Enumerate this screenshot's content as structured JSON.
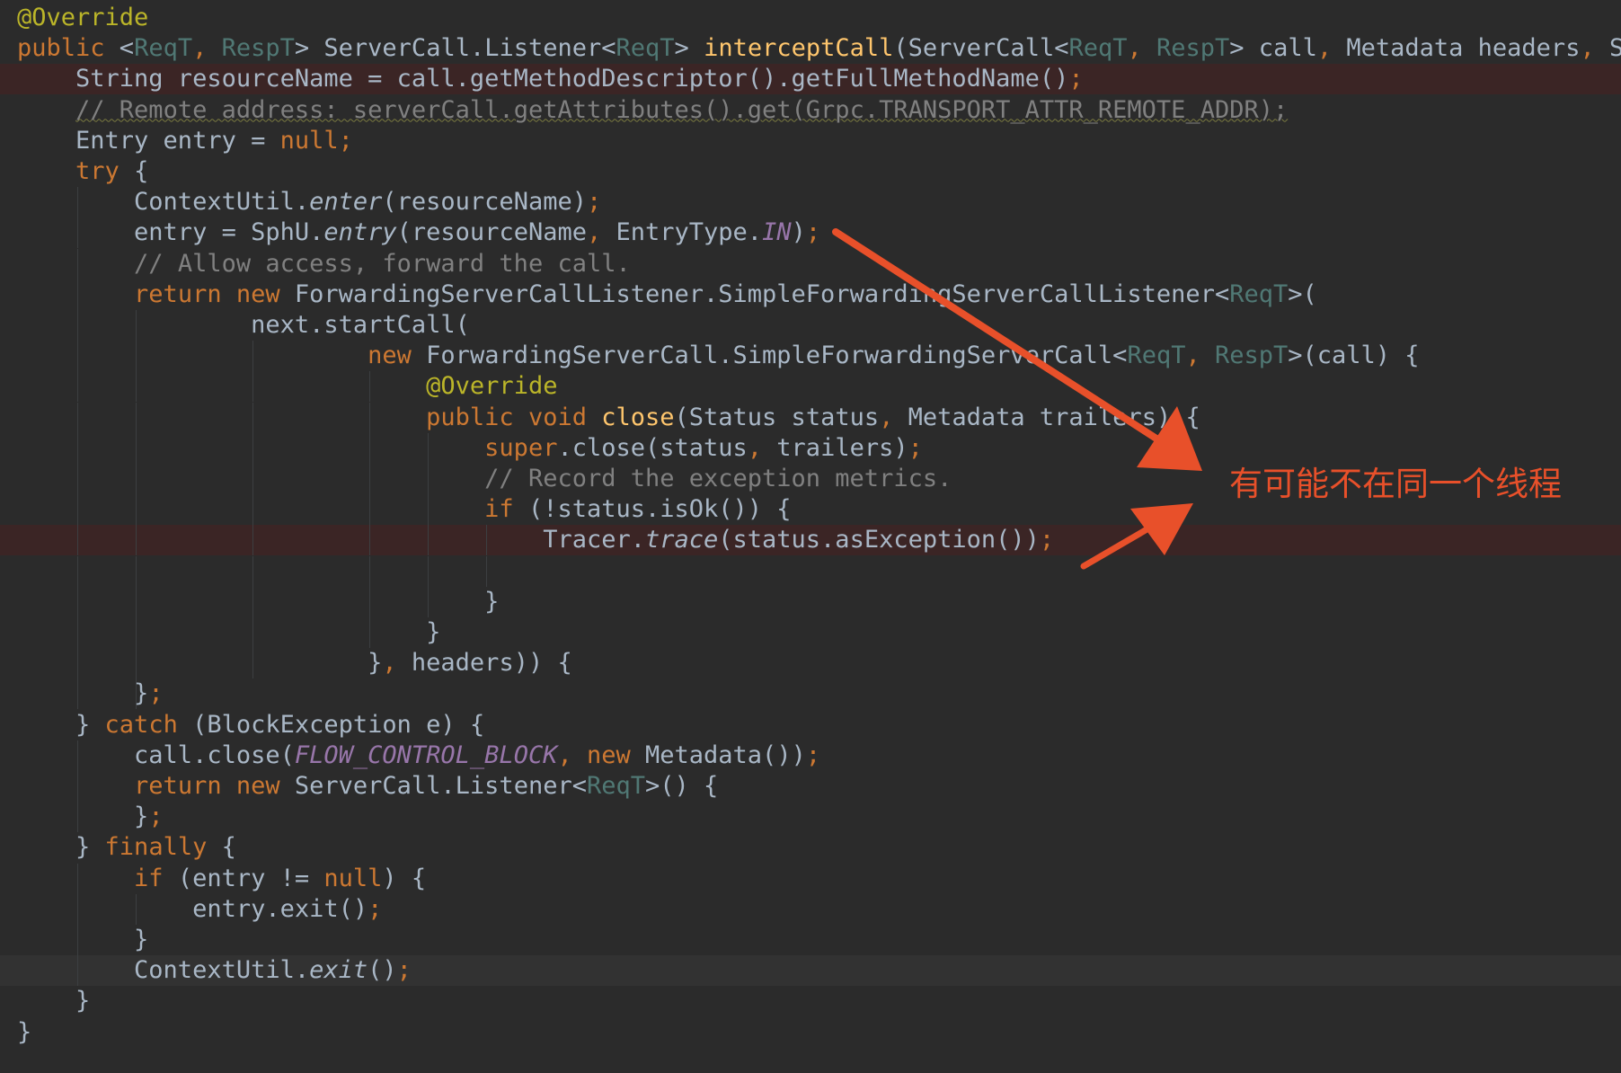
{
  "colors": {
    "background": "#2b2b2b",
    "error_line": "#3b2525",
    "current_line": "#323232",
    "keyword": "#cc7832",
    "annotation": "#bbb529",
    "generic": "#507874",
    "method_decl": "#ffc66d",
    "comment": "#808080",
    "constant": "#9876aa",
    "plain": "#a9b7c6",
    "callout": "#e8502a"
  },
  "callout_text": "有可能不在同一个线程",
  "code_lines": [
    {
      "hl": "",
      "guides": [],
      "tokens": [
        [
          "@Override",
          "ann"
        ]
      ]
    },
    {
      "hl": "",
      "guides": [],
      "tokens": [
        [
          "public ",
          "kw"
        ],
        [
          "<",
          ""
        ],
        [
          "ReqT",
          "gen"
        ],
        [
          ", ",
          "kw"
        ],
        [
          "RespT",
          "gen"
        ],
        [
          "> ServerCall.Listener<",
          ""
        ],
        [
          "ReqT",
          "gen"
        ],
        [
          "> ",
          ""
        ],
        [
          "interceptCall",
          "fn"
        ],
        [
          "(ServerCall<",
          ""
        ],
        [
          "ReqT",
          "gen"
        ],
        [
          ", ",
          "kw"
        ],
        [
          "RespT",
          "gen"
        ],
        [
          "> call",
          ""
        ],
        [
          ", ",
          "kw"
        ],
        [
          "Metadata headers",
          ""
        ],
        [
          ", ",
          "kw"
        ],
        [
          "Ser",
          ""
        ]
      ]
    },
    {
      "hl": "err",
      "guides": [],
      "tokens": [
        [
          "    String resourceName = call.getMethodDescriptor().getFullMethodName()",
          ""
        ],
        [
          ";",
          "kw"
        ]
      ]
    },
    {
      "hl": "",
      "guides": [],
      "tokens": [
        [
          "    ",
          ""
        ],
        [
          "// Remote address: serverCall.getAttributes().get(Grpc.TRANSPORT_ATTR_REMOTE_ADDR);",
          "comu"
        ]
      ]
    },
    {
      "hl": "",
      "guides": [],
      "tokens": [
        [
          "    Entry entry = ",
          ""
        ],
        [
          "null;",
          "kw"
        ]
      ]
    },
    {
      "hl": "",
      "guides": [],
      "tokens": [
        [
          "    ",
          ""
        ],
        [
          "try ",
          "kw"
        ],
        [
          "{",
          ""
        ]
      ]
    },
    {
      "hl": "",
      "guides": [
        4
      ],
      "tokens": [
        [
          "        ContextUtil.",
          ""
        ],
        [
          "enter",
          "it"
        ],
        [
          "(resourceName)",
          ""
        ],
        [
          ";",
          "kw"
        ]
      ]
    },
    {
      "hl": "",
      "guides": [
        4
      ],
      "tokens": [
        [
          "        entry = SphU.",
          ""
        ],
        [
          "entry",
          "it"
        ],
        [
          "(resourceName",
          ""
        ],
        [
          ", ",
          "kw"
        ],
        [
          "EntryType.",
          ""
        ],
        [
          "IN",
          "fld"
        ],
        [
          ")",
          ""
        ],
        [
          ";",
          "kw"
        ]
      ]
    },
    {
      "hl": "",
      "guides": [
        4
      ],
      "tokens": [
        [
          "        ",
          ""
        ],
        [
          "// Allow access, forward the call.",
          "com"
        ]
      ]
    },
    {
      "hl": "",
      "guides": [
        4
      ],
      "tokens": [
        [
          "        ",
          ""
        ],
        [
          "return new ",
          "kw"
        ],
        [
          "ForwardingServerCallListener.SimpleForwardingServerCallListener<",
          ""
        ],
        [
          "ReqT",
          "gen"
        ],
        [
          ">(",
          ""
        ]
      ]
    },
    {
      "hl": "",
      "guides": [
        4,
        8
      ],
      "tokens": [
        [
          "                next.startCall(",
          ""
        ]
      ]
    },
    {
      "hl": "",
      "guides": [
        4,
        8,
        16
      ],
      "tokens": [
        [
          "                        ",
          ""
        ],
        [
          "new ",
          "kw"
        ],
        [
          "ForwardingServerCall.SimpleForwardingServerCall<",
          ""
        ],
        [
          "ReqT",
          "gen"
        ],
        [
          ", ",
          "kw"
        ],
        [
          "RespT",
          "gen"
        ],
        [
          ">(call) {",
          ""
        ]
      ]
    },
    {
      "hl": "",
      "guides": [
        4,
        8,
        16,
        24
      ],
      "tokens": [
        [
          "                            ",
          ""
        ],
        [
          "@Override",
          "ann"
        ]
      ]
    },
    {
      "hl": "",
      "guides": [
        4,
        8,
        16,
        24
      ],
      "tokens": [
        [
          "                            ",
          ""
        ],
        [
          "public void ",
          "kw"
        ],
        [
          "close",
          "fn"
        ],
        [
          "(Status status",
          ""
        ],
        [
          ", ",
          "kw"
        ],
        [
          "Metadata trailers) {",
          ""
        ]
      ]
    },
    {
      "hl": "",
      "guides": [
        4,
        8,
        16,
        24,
        28
      ],
      "tokens": [
        [
          "                                ",
          ""
        ],
        [
          "super",
          "kw"
        ],
        [
          ".close(status",
          ""
        ],
        [
          ", ",
          "kw"
        ],
        [
          "trailers)",
          ""
        ],
        [
          ";",
          "kw"
        ]
      ]
    },
    {
      "hl": "",
      "guides": [
        4,
        8,
        16,
        24,
        28
      ],
      "tokens": [
        [
          "                                ",
          ""
        ],
        [
          "// Record the exception metrics.",
          "com"
        ]
      ]
    },
    {
      "hl": "",
      "guides": [
        4,
        8,
        16,
        24,
        28
      ],
      "tokens": [
        [
          "                                ",
          ""
        ],
        [
          "if ",
          "kw"
        ],
        [
          "(!status.isOk()) {",
          ""
        ]
      ]
    },
    {
      "hl": "err",
      "guides": [
        4,
        8,
        16,
        24,
        28,
        32
      ],
      "tokens": [
        [
          "                                    Tracer.",
          ""
        ],
        [
          "trace",
          "it"
        ],
        [
          "(status.asException())",
          ""
        ],
        [
          ";",
          "kw"
        ]
      ]
    },
    {
      "hl": "",
      "guides": [
        4,
        8,
        16,
        24,
        28,
        32
      ],
      "tokens": [
        [
          "",
          ""
        ]
      ]
    },
    {
      "hl": "",
      "guides": [
        4,
        8,
        16,
        24,
        28
      ],
      "tokens": [
        [
          "                                }",
          ""
        ]
      ]
    },
    {
      "hl": "",
      "guides": [
        4,
        8,
        16,
        24
      ],
      "tokens": [
        [
          "                            }",
          ""
        ]
      ]
    },
    {
      "hl": "",
      "guides": [
        4,
        8,
        16
      ],
      "tokens": [
        [
          "                        }",
          ""
        ],
        [
          ", ",
          "kw"
        ],
        [
          "headers)) {",
          ""
        ]
      ]
    },
    {
      "hl": "",
      "guides": [
        4,
        8
      ],
      "tokens": [
        [
          "        }",
          ""
        ],
        [
          ";",
          "kw"
        ]
      ]
    },
    {
      "hl": "",
      "guides": [],
      "tokens": [
        [
          "    } ",
          ""
        ],
        [
          "catch ",
          "kw"
        ],
        [
          "(BlockException e) {",
          ""
        ]
      ]
    },
    {
      "hl": "",
      "guides": [
        4
      ],
      "tokens": [
        [
          "        call.close(",
          ""
        ],
        [
          "FLOW_CONTROL_BLOCK",
          "fld"
        ],
        [
          ", ",
          "kw"
        ],
        [
          "new ",
          "kw"
        ],
        [
          "Metadata())",
          ""
        ],
        [
          ";",
          "kw"
        ]
      ]
    },
    {
      "hl": "",
      "guides": [
        4
      ],
      "tokens": [
        [
          "        ",
          ""
        ],
        [
          "return new ",
          "kw"
        ],
        [
          "ServerCall.Listener<",
          ""
        ],
        [
          "ReqT",
          "gen"
        ],
        [
          ">() {",
          ""
        ]
      ]
    },
    {
      "hl": "",
      "guides": [
        4
      ],
      "tokens": [
        [
          "        }",
          ""
        ],
        [
          ";",
          "kw"
        ]
      ]
    },
    {
      "hl": "",
      "guides": [],
      "tokens": [
        [
          "    } ",
          ""
        ],
        [
          "finally ",
          "kw"
        ],
        [
          "{",
          ""
        ]
      ]
    },
    {
      "hl": "",
      "guides": [
        4
      ],
      "tokens": [
        [
          "        ",
          ""
        ],
        [
          "if ",
          "kw"
        ],
        [
          "(entry != ",
          ""
        ],
        [
          "null",
          "kw"
        ],
        [
          ") {",
          ""
        ]
      ]
    },
    {
      "hl": "",
      "guides": [
        4,
        8
      ],
      "tokens": [
        [
          "            entry.exit()",
          ""
        ],
        [
          ";",
          "kw"
        ]
      ]
    },
    {
      "hl": "",
      "guides": [
        4
      ],
      "tokens": [
        [
          "        }",
          ""
        ]
      ]
    },
    {
      "hl": "cur",
      "guides": [
        4
      ],
      "tokens": [
        [
          "        ContextUtil.",
          ""
        ],
        [
          "exit",
          "it"
        ],
        [
          "()",
          ""
        ],
        [
          ";",
          "kw"
        ]
      ]
    },
    {
      "hl": "",
      "guides": [],
      "tokens": [
        [
          "    }",
          ""
        ]
      ]
    },
    {
      "hl": "",
      "guides": [],
      "tokens": [
        [
          "}",
          ""
        ]
      ]
    }
  ]
}
